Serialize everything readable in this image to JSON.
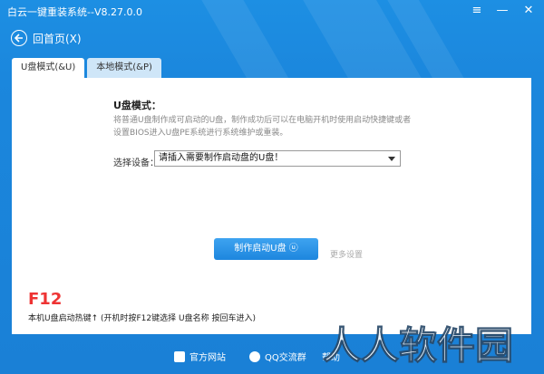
{
  "titlebar": {
    "app_title": "白云一键重装系统--V8.27.0.0",
    "menu_icon": "≡",
    "minimize_icon": "—",
    "close_icon": "✕"
  },
  "nav": {
    "back_label": "回首页(X)"
  },
  "tabs": [
    {
      "label": "U盘模式(&U)",
      "active": true
    },
    {
      "label": "本地模式(&P)",
      "active": false
    }
  ],
  "panel": {
    "mode_title": "U盘模式：",
    "mode_desc": "将普通U盘制作成可启动的U盘，制作成功后可以在电脑开机时使用启动快捷键或者设置BIOS进入U盘PE系统进行系统维护或重装。",
    "device_label": "选择设备：",
    "device_value": "请插入需要制作启动盘的U盘！",
    "make_button": "制作启动U盘 ⓤ",
    "more_settings": "更多设置",
    "hotkey": "F12",
    "hotkey_note": "本机U盘启动热键↑ (开机时按F12键选择 U盘名称 按回车进入)"
  },
  "footer": {
    "links": [
      {
        "label": "官方网站"
      },
      {
        "label": "QQ交流群"
      },
      {
        "label": "帮助"
      }
    ]
  },
  "watermark": {
    "text": "人人软件园"
  }
}
